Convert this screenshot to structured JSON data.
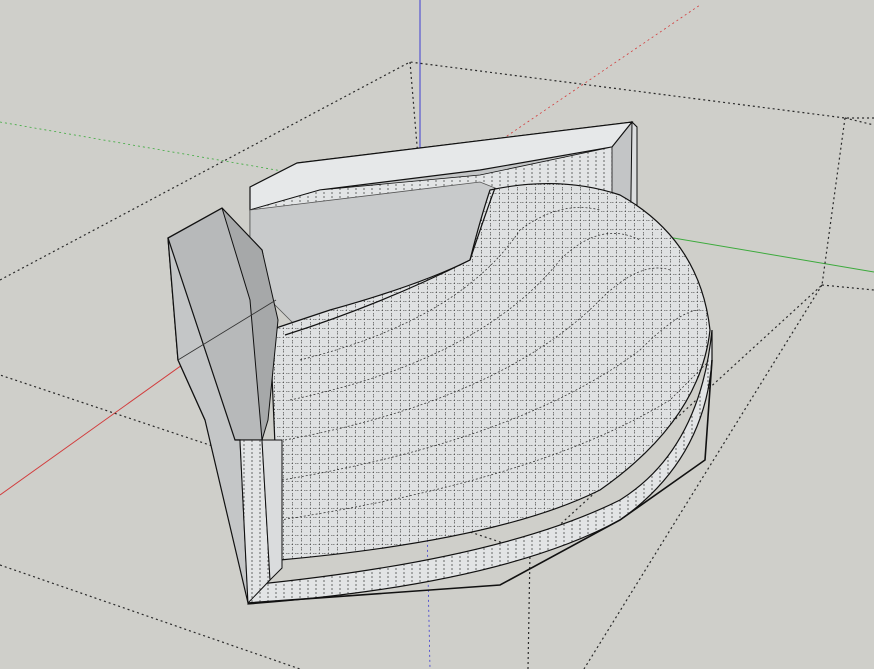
{
  "viewport": {
    "background": "#cfcfca",
    "colors": {
      "axis_red": "#d23c3c",
      "axis_green": "#3caa3c",
      "axis_blue": "#3c3cd2",
      "bbox_dotted": "#2a2a2a",
      "surface_light": "#e4e6e7",
      "surface_mid": "#c7c9ca",
      "surface_dark": "#a9abac",
      "edge": "#111111"
    },
    "model": "curved-stadium-seating-shell"
  }
}
